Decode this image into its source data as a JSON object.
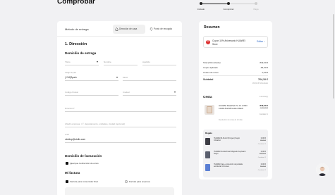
{
  "page": {
    "title": "Comprobar"
  },
  "stepper": {
    "steps": [
      "Iniciado",
      "Comprobar",
      "Pago"
    ]
  },
  "checkout": {
    "delivery_method_label": "Método de entrega",
    "tabs": {
      "home": "Dirección de casa",
      "pickup": "Punto de recogida"
    },
    "section_title": "1. Dirección",
    "delivery_address_title": "Domicilio de entrega",
    "fields": {
      "title_ph": "Título",
      "name_ph": "Nombre",
      "surname_ph": "Apellido",
      "prefix_label": "Código de país",
      "prefix_value": "(+34)Spain",
      "phone_ph": "Móvil",
      "postal_ph": "Código Postal",
      "city_ph": "Ciudad",
      "address_ph": "Dirección*",
      "address2_ph": "Añadir empresa, n.º, departamento, unidades, ciudad (opcional)",
      "email_label": "email",
      "email_value": "ctoldsp@stolls.com"
    },
    "billing_title": "Domicilio de facturación",
    "billing_same": "Igual que la dirección de envío",
    "invoice_title": "Mi factura",
    "invoice_consumer": "Factura para consumidor final",
    "invoice_company": "Factura para empresa"
  },
  "summary": {
    "title": "Resumen",
    "coupon_name": "Cupon 10% Aniversario HUAWEI Store",
    "coupon_edit": "Editar",
    "rows": [
      {
        "label": "Total (IVA incluido)",
        "value": "849,00 €"
      },
      {
        "label": "Cupón aplicado",
        "value": "-84,90 €"
      },
      {
        "label": "Costes de envío",
        "value": "0,00 €"
      }
    ],
    "subtotal_label": "Subtotal",
    "subtotal_value": "764,10 €",
    "vat_note": "133,61 € IVA incluido",
    "cart_title": "Cesta",
    "cart_count": "1 artículo(s)",
    "product": {
      "name": "HUAWEI MatePad Pro 13.2 WiFi 12GB+512GB Golden Black",
      "price": "849,00 €",
      "old_price": "1.049,00 €",
      "qty": "Cantidad: 1",
      "note": "Devolución sin coste de 14 días"
    },
    "gifts_title": "Regalo",
    "gifts": [
      {
        "name": "HUAWEI M-Pencil (3rd gen) Negro Cristalino",
        "price": "0,00 €",
        "old": "99,00 €",
        "qty": "Cantidad: 1"
      },
      {
        "name": "HUAWEI Funda Smart Magnetic Keyboard Negro",
        "price": "0,00 €",
        "old": "199,00 €",
        "qty": "Cantidad: 1"
      },
      {
        "name": "HUAWEI Care+ protección de pantalla accidental 12 meses",
        "price": "0,00 €",
        "old": "59,00 €",
        "qty": "Cantidad: 1"
      }
    ]
  },
  "colors": {
    "accent": "#2463c6",
    "coupon": "#dd3333",
    "dark": "#111111"
  }
}
